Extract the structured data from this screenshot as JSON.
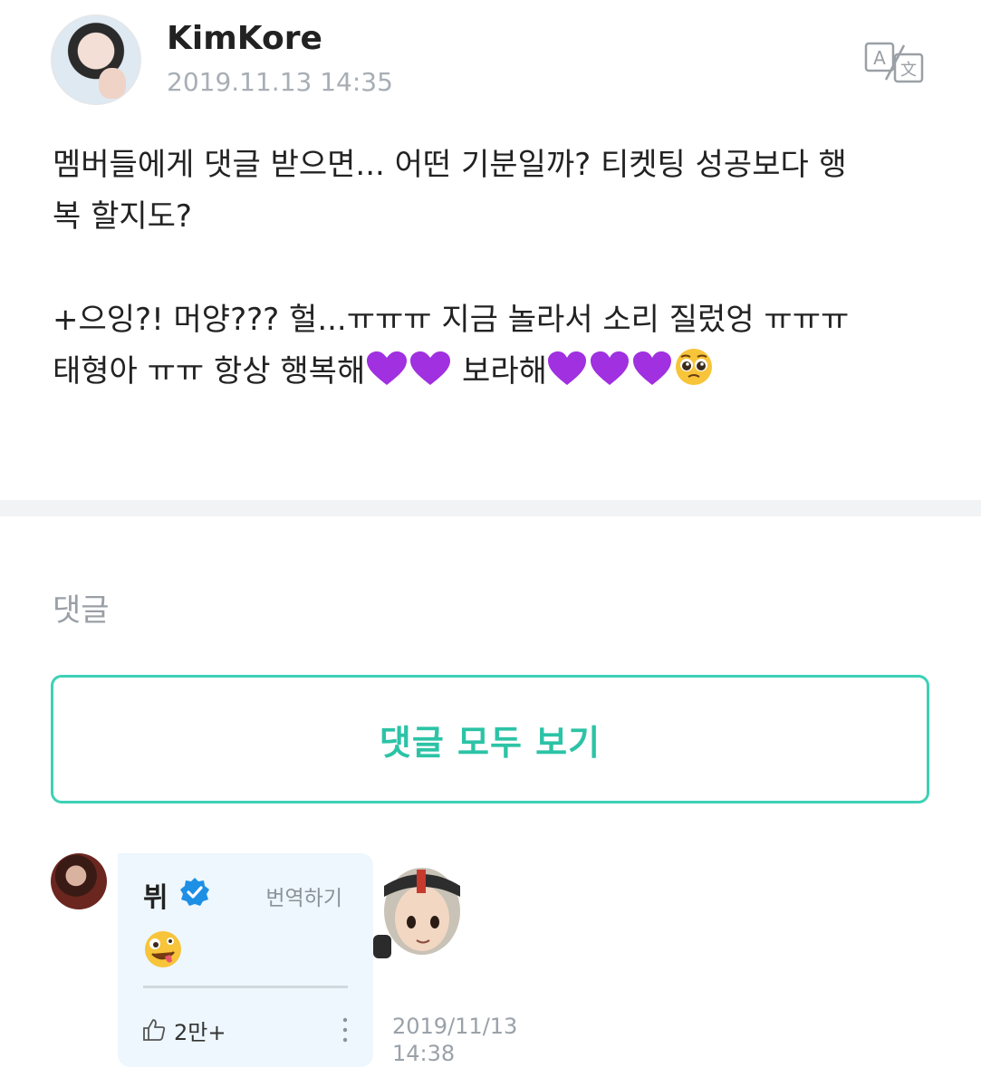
{
  "post": {
    "author": "KimKore",
    "timestamp": "2019.11.13 14:35",
    "line1": "멤버들에게 댓글 받으면... 어떤 기분일까? 티켓팅 성공보다 행",
    "line2": "복 할지도?",
    "line3": "+으잉?! 머양??? 헐...ㅠㅠㅠ 지금 놀라서 소리 질렀엉 ㅠㅠㅠ",
    "line4a": "태형아 ㅠㅠ 항상 행복해",
    "line4b": " 보라해",
    "translate_icon": "translate-icon"
  },
  "comments": {
    "label": "댓글",
    "view_all": "댓글 모두 보기",
    "items": [
      {
        "name": "뷔",
        "verified": true,
        "translate_label": "번역하기",
        "content_icon": "zany-face-emoji",
        "likes": "2만+",
        "timestamp": "2019/11/13\n14:38",
        "date": "2019/11/13",
        "time": "14:38"
      }
    ]
  },
  "colors": {
    "accent": "#2cc3a6",
    "bubble": "#edf7fd",
    "muted": "#a8aeb5",
    "heart": "#a030e0",
    "verified": "#1d8fe5"
  }
}
